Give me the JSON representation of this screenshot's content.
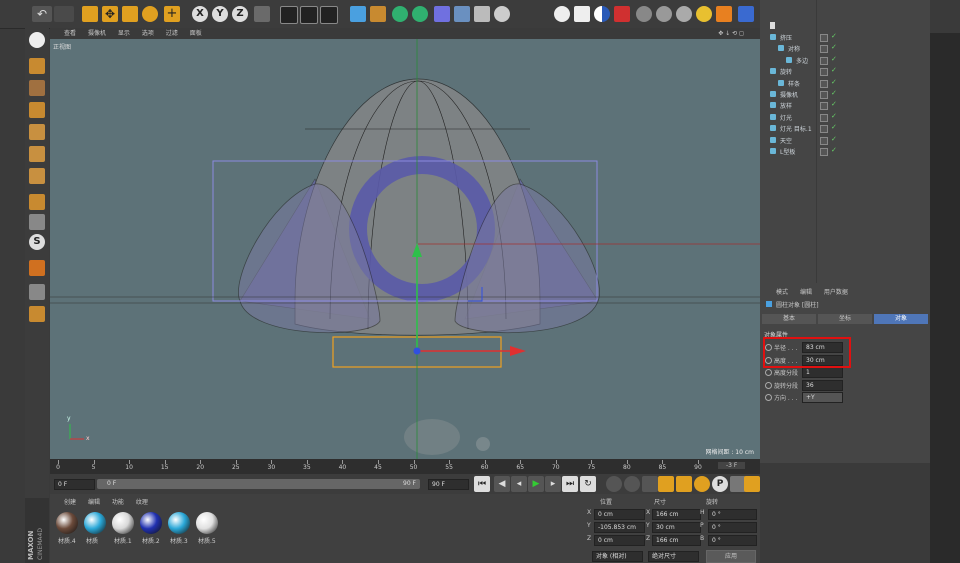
{
  "viewport": {
    "menu": [
      "查看",
      "摄像机",
      "显示",
      "选项",
      "过滤",
      "面板"
    ],
    "view_name": "正视图",
    "grid_label": "网格间距 : 10 cm"
  },
  "object_manager": {
    "items": [
      {
        "name": "挤压",
        "indent": 0
      },
      {
        "name": "对称",
        "indent": 1
      },
      {
        "name": "多边",
        "indent": 2
      },
      {
        "name": "旋转",
        "indent": 0
      },
      {
        "name": "样条",
        "indent": 1
      },
      {
        "name": "摄像机",
        "indent": 0
      },
      {
        "name": "放样",
        "indent": 0
      },
      {
        "name": "灯光",
        "indent": 0
      },
      {
        "name": "灯光 目标.1",
        "indent": 0
      },
      {
        "name": "天空",
        "indent": 0
      },
      {
        "name": "L型板",
        "indent": 0
      }
    ]
  },
  "attributes": {
    "menu": [
      "模式",
      "编辑",
      "用户数据"
    ],
    "object_title": "圆柱对象 [圆柱]",
    "tabs": [
      "基本",
      "坐标",
      "对象"
    ],
    "active_tab": 2,
    "section": "对象属性",
    "fields": [
      {
        "label": "半径 . . .",
        "value": "83 cm"
      },
      {
        "label": "高度 . . .",
        "value": "30 cm"
      },
      {
        "label": "高度分段",
        "value": "1"
      },
      {
        "label": "旋转分段",
        "value": "36"
      },
      {
        "label": "方向 . . .",
        "value": "+Y"
      }
    ]
  },
  "timeline": {
    "ticks": [
      "0",
      "5",
      "10",
      "15",
      "20",
      "25",
      "30",
      "35",
      "40",
      "45",
      "50",
      "55",
      "60",
      "65",
      "70",
      "75",
      "80",
      "85",
      "90"
    ],
    "frame_end_indicator": "-3 F",
    "start_frame": "0 F",
    "current_frame": "0 F",
    "end_frame": "90 F",
    "end_frame_2": "90 F"
  },
  "materials": {
    "menu": [
      "创建",
      "编辑",
      "功能",
      "纹理"
    ],
    "items": [
      {
        "name": "材质.4",
        "color": "#6b4a3a"
      },
      {
        "name": "材质",
        "color": "#2aa8d8"
      },
      {
        "name": "材质.1",
        "color": "#d8d8d8"
      },
      {
        "name": "材质.2",
        "color": "#2030b0"
      },
      {
        "name": "材质.3",
        "color": "#2aa8d8"
      },
      {
        "name": "材质.5",
        "color": "#e0e0e0"
      }
    ]
  },
  "coordinates": {
    "headers": [
      "位置",
      "尺寸",
      "旋转"
    ],
    "rows": [
      {
        "axis": "X",
        "pos": "0 cm",
        "size_axis": "X",
        "size": "166 cm",
        "rot_axis": "H",
        "rot": "0 °"
      },
      {
        "axis": "Y",
        "pos": "-105.853 cm",
        "size_axis": "Y",
        "size": "30 cm",
        "rot_axis": "P",
        "rot": "0 °"
      },
      {
        "axis": "Z",
        "pos": "0 cm",
        "size_axis": "Z",
        "size": "166 cm",
        "rot_axis": "B",
        "rot": "0 °"
      }
    ],
    "mode_select": "对象 (相对)",
    "size_select": "绝对尺寸",
    "apply_label": "应用"
  },
  "brand": {
    "line1": "MAXON",
    "line2": "CINEMA4D"
  },
  "colors": {
    "viewport_bg": "#5d7278",
    "highlight_red": "#e01010",
    "active_tab": "#4f76b8",
    "timeline_bg": "#2e2e2e"
  }
}
